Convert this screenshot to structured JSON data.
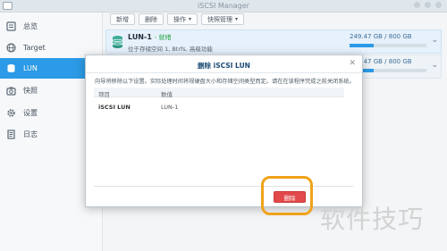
{
  "window": {
    "title": "iSCSI Manager"
  },
  "sidebar": {
    "items": [
      {
        "label": "总览",
        "icon": "overview-icon"
      },
      {
        "label": "Target",
        "icon": "globe-icon"
      },
      {
        "label": "LUN",
        "icon": "database-icon",
        "active": true
      },
      {
        "label": "快照",
        "icon": "camera-icon"
      },
      {
        "label": "设置",
        "icon": "gear-icon"
      },
      {
        "label": "日志",
        "icon": "log-icon"
      }
    ]
  },
  "toolbar": {
    "new_label": "新增",
    "delete_label": "删除",
    "action_label": "操作",
    "snapshot_label": "快照管理"
  },
  "luns": [
    {
      "name": "LUN-1",
      "status": "- 就绪",
      "description": "位于存储空间 1, Btrfs, 高级功能",
      "capacity": "249.47 GB / 800 GB",
      "usage_fraction": 0.31
    },
    {
      "capacity": "249.47 GB / 800 GB",
      "usage_fraction": 0.31
    }
  ],
  "modal": {
    "title": "删除 iSCSI LUN",
    "message": "向导将移除以下设置。实际处理时间将视硬盘大小和存储空间类型而定。请在在该程序完成之前关闭系统。",
    "table": {
      "headers": [
        "项目",
        "数值"
      ],
      "rows": [
        [
          "iSCSI LUN",
          "LUN-1"
        ]
      ]
    },
    "delete_label": "删除"
  },
  "watermark": "软件技巧",
  "colors": {
    "accent": "#2c9ae6",
    "danger": "#e2494a",
    "highlight": "#f0a21a"
  }
}
